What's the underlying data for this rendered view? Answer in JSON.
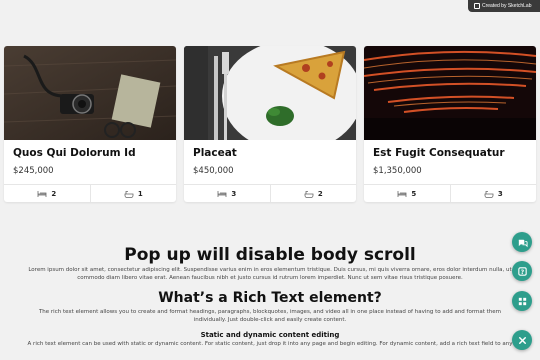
{
  "badge": {
    "text": "Created by SketchLab"
  },
  "cards": [
    {
      "title": "Quos Qui Dolorum Id",
      "price": "$245,000",
      "beds": "2",
      "baths": "1"
    },
    {
      "title": "Placeat",
      "price": "$450,000",
      "beds": "3",
      "baths": "2"
    },
    {
      "title": "Est Fugit Consequatur",
      "price": "$1,350,000",
      "beds": "5",
      "baths": "3"
    }
  ],
  "content": {
    "heading": "Pop up will disable body scroll",
    "intro": "Lorem ipsum dolor sit amet, consectetur adipiscing elit. Suspendisse varius enim in eros elementum tristique. Duis cursus, mi quis viverra ornare, eros dolor interdum nulla, ut commodo diam libero vitae erat. Aenean faucibus nibh et justo cursus id rutrum lorem imperdiet. Nunc ut sem vitae risus tristique posuere.",
    "subheading": "What’s a Rich Text element?",
    "rich_text": "The rich text element allows you to create and format headings, paragraphs, blockquotes, images, and video all in one place instead of having to add and format them individually. Just double-click and easily create content.",
    "h3": "Static and dynamic content editing",
    "tail": "A rich text element can be used with static or dynamic content. For static content, just drop it into any page and begin editing. For dynamic content, add a rich text field to any"
  },
  "fabs": [
    "chat-icon",
    "help-icon",
    "grid-icon",
    "close-icon"
  ]
}
